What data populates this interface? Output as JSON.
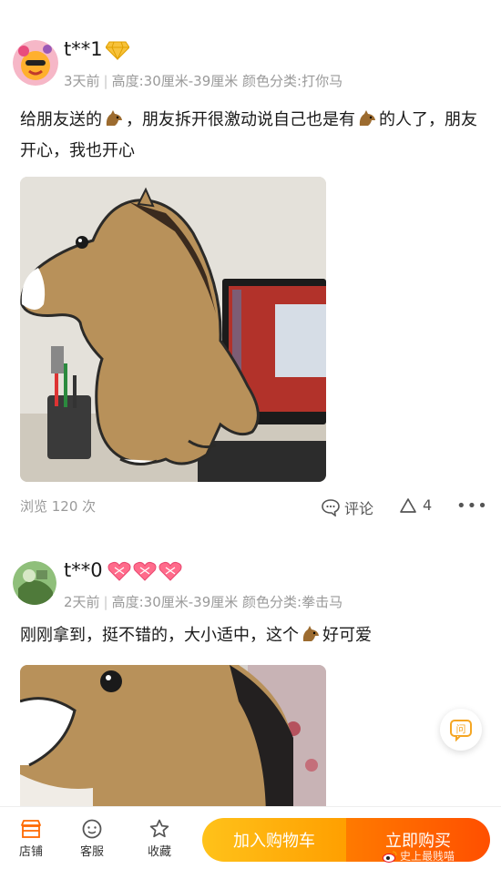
{
  "reviews": [
    {
      "username": "t**1",
      "meta": {
        "time": "3天前",
        "size": "高度:30厘米-39厘米",
        "variant": "颜色分类:打你马"
      },
      "text_parts": [
        "给朋友送的",
        "，朋友拆开很激动说自己也是有",
        "的人了，朋友开心，我也开心"
      ],
      "views": "浏览 120 次",
      "comment_label": "评论",
      "like_count": "4"
    },
    {
      "username": "t**0",
      "meta": {
        "time": "2天前",
        "size": "高度:30厘米-39厘米",
        "variant": "颜色分类:拳击马"
      },
      "text_parts": [
        "刚刚拿到，挺不错的，大小适中，这个",
        "好可爱"
      ]
    }
  ],
  "bottom_bar": {
    "shop": "店铺",
    "service": "客服",
    "favorite": "收藏",
    "add_to_cart": "加入购物车",
    "buy_now": "立即购买"
  },
  "float_button": "问",
  "watermark": "史上最贱喵",
  "colors": {
    "accent_orange": "#ff7a00",
    "accent_yellow": "#ffc21a",
    "meta_gray": "#9a9a9a"
  },
  "icons": [
    "gold-diamond-icon",
    "heart-badge-icon",
    "horse-emoji-icon",
    "comment-icon",
    "triangle-like-icon",
    "more-icon",
    "store-icon",
    "service-icon",
    "star-icon",
    "ask-icon",
    "weibo-icon"
  ]
}
